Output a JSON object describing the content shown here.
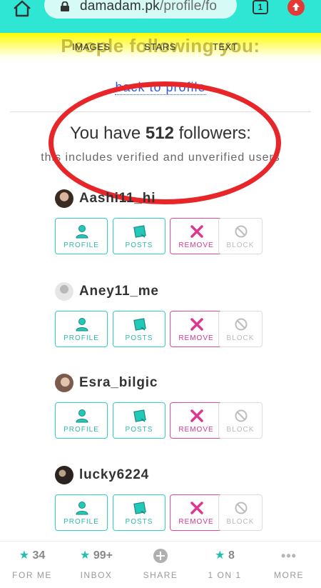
{
  "browser": {
    "url_domain": "damadam.pk",
    "url_path": "/profile/fo",
    "tab_count": "1"
  },
  "page": {
    "heading": "People following you:",
    "tabs": [
      "IMAGES",
      "STARS",
      "TEXT"
    ],
    "back_link": "back to profile",
    "followers_prefix": "You have",
    "followers_count": "512",
    "followers_suffix": "followers:",
    "followers_note": "this includes verified and unverified users"
  },
  "buttons": {
    "profile": "PROFILE",
    "posts": "POSTS",
    "remove": "REMOVE",
    "block": "BLOCK"
  },
  "users": [
    {
      "name": "Aashi11_hi"
    },
    {
      "name": "Aney11_me"
    },
    {
      "name": "Esra_bilgic"
    },
    {
      "name": "lucky6224"
    }
  ],
  "bottom_nav": [
    {
      "top": "34",
      "label": "FOR ME",
      "icon": "star-icon"
    },
    {
      "top": "99+",
      "label": "INBOX",
      "icon": "star-icon"
    },
    {
      "top": "",
      "label": "SHARE",
      "icon": "plus-circle-icon"
    },
    {
      "top": "8",
      "label": "1 ON 1",
      "icon": "star-icon"
    },
    {
      "top": "•••",
      "label": "MORE",
      "icon": "dots-icon"
    }
  ],
  "colors": {
    "browser_bar": "#2ee6d3",
    "accent_teal": "#2ed0bf",
    "remove_pink": "#d84d9a",
    "circle_red": "#e8262a"
  }
}
